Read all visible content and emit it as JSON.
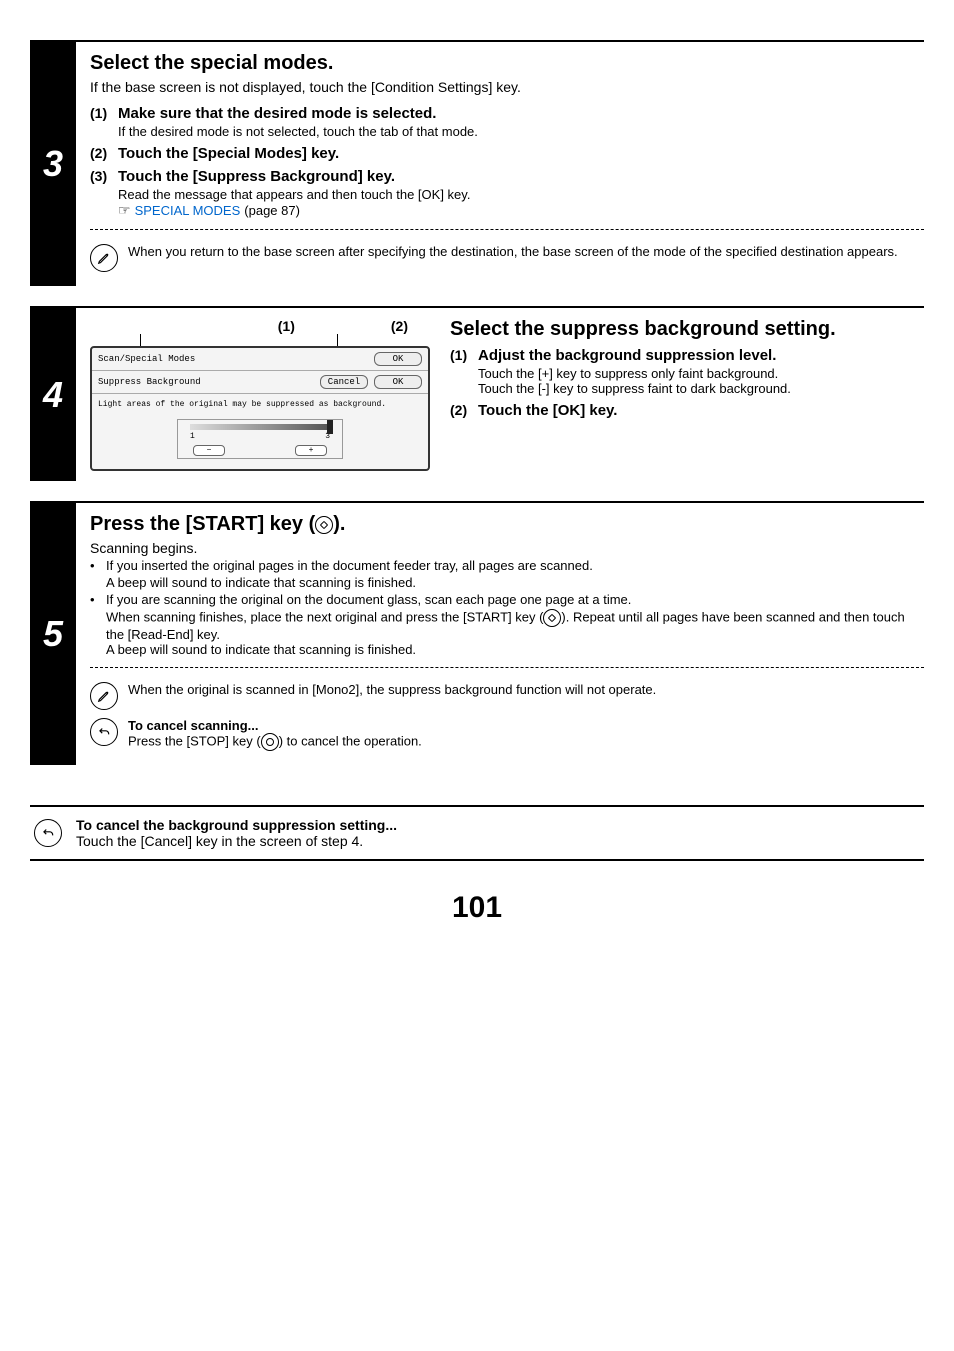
{
  "step3": {
    "num": "3",
    "heading": "Select the special modes.",
    "intro": "If the base screen is not displayed, touch the [Condition Settings] key.",
    "items": [
      {
        "num": "(1)",
        "title": "Make sure that the desired mode is selected.",
        "body": "If the desired mode is not selected, touch the tab of that mode."
      },
      {
        "num": "(2)",
        "title": "Touch the [Special Modes] key."
      },
      {
        "num": "(3)",
        "title": "Touch the [Suppress Background] key.",
        "body": "Read the message that appears and then touch the [OK] key."
      }
    ],
    "xref_link": "SPECIAL MODES",
    "xref_page": " (page 87)",
    "note": "When you return to the base screen after specifying the destination, the base screen of the mode of the specified destination appears."
  },
  "step4": {
    "num": "4",
    "markers": {
      "a": "(1)",
      "b": "(2)"
    },
    "panel": {
      "row1_label": "Scan/Special Modes",
      "row1_ok": "OK",
      "row2_label": "Suppress Background",
      "row2_cancel": "Cancel",
      "row2_ok": "OK",
      "body_msg": "Light areas of the original may be suppressed as background.",
      "scale_lo": "1",
      "scale_hi": "3",
      "minus": "−",
      "plus": "+"
    },
    "heading": "Select the suppress background setting.",
    "items": [
      {
        "num": "(1)",
        "title": "Adjust the background suppression level.",
        "body1": "Touch the [+] key to suppress only faint background.",
        "body2": "Touch the [-] key to suppress faint to dark background."
      },
      {
        "num": "(2)",
        "title": "Touch the [OK] key."
      }
    ]
  },
  "step5": {
    "num": "5",
    "heading_pre": "Press the [START] key (",
    "heading_post": ").",
    "intro": "Scanning begins.",
    "b1a": "If you inserted the original pages in the document feeder tray, all pages are scanned.",
    "b1b": "A beep will sound to indicate that scanning is finished.",
    "b2a": "If you are scanning the original on the document glass, scan each page one page at a time.",
    "b2b_pre": "When scanning finishes, place the next original and press the [START] key (",
    "b2b_post": "). Repeat until all pages have been scanned and then touch the [Read-End] key.",
    "b2c": "A beep will sound to indicate that scanning is finished.",
    "note": "When the original is scanned in [Mono2], the suppress background function will not operate.",
    "cancel_title": "To cancel scanning...",
    "cancel_body_pre": "Press the [STOP] key (",
    "cancel_body_post": ") to cancel the operation."
  },
  "footer": {
    "title": "To cancel the background suppression setting...",
    "body": "Touch the [Cancel] key in the screen of step 4."
  },
  "page_number": "101",
  "bullet_glyph": "•"
}
